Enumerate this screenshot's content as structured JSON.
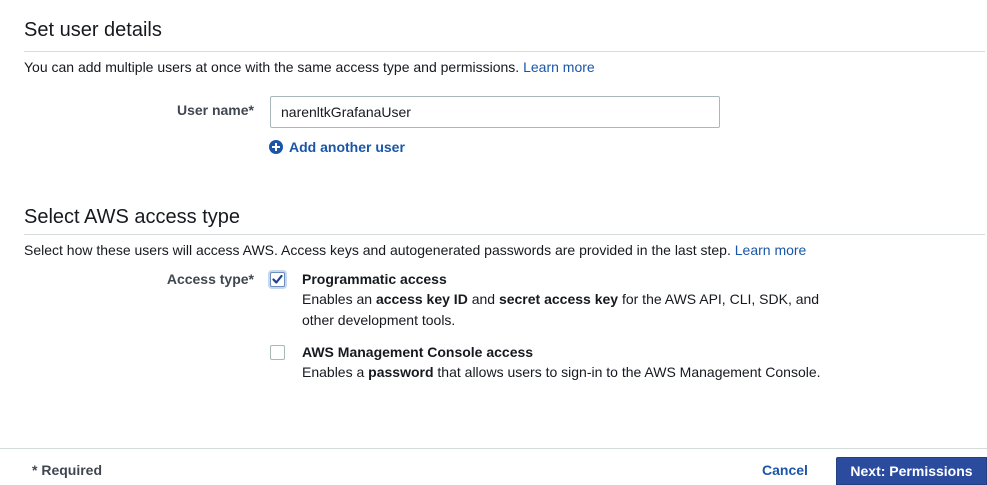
{
  "user_details": {
    "title": "Set user details",
    "description": "You can add multiple users at once with the same access type and permissions.",
    "learn_more": "Learn more",
    "user_name_label": "User name*",
    "user_name_value": "narenltkGrafanaUser",
    "add_another_user": "Add another user"
  },
  "access_type": {
    "title": "Select AWS access type",
    "description": "Select how these users will access AWS. Access keys and autogenerated passwords are provided in the last step.",
    "learn_more": "Learn more",
    "label": "Access type*",
    "options": [
      {
        "title": "Programmatic access",
        "checked": true,
        "desc_prefix": "Enables an ",
        "desc_bold1": "access key ID",
        "desc_mid": " and ",
        "desc_bold2": "secret access key",
        "desc_suffix": " for the AWS API, CLI, SDK, and other development tools."
      },
      {
        "title": "AWS Management Console access",
        "checked": false,
        "desc_prefix": "Enables a ",
        "desc_bold1": "password",
        "desc_suffix": " that allows users to sign-in to the AWS Management Console."
      }
    ]
  },
  "footer": {
    "required_note": "* Required",
    "cancel_label": "Cancel",
    "next_label": "Next: Permissions"
  },
  "colors": {
    "link": "#1a56a8",
    "primary_button": "#2a4b9e",
    "divider": "#d5dbdb",
    "check": "#1f3f8f"
  },
  "icons": {
    "add_user": "plus-circle-icon",
    "checkmark": "checkmark-icon"
  }
}
